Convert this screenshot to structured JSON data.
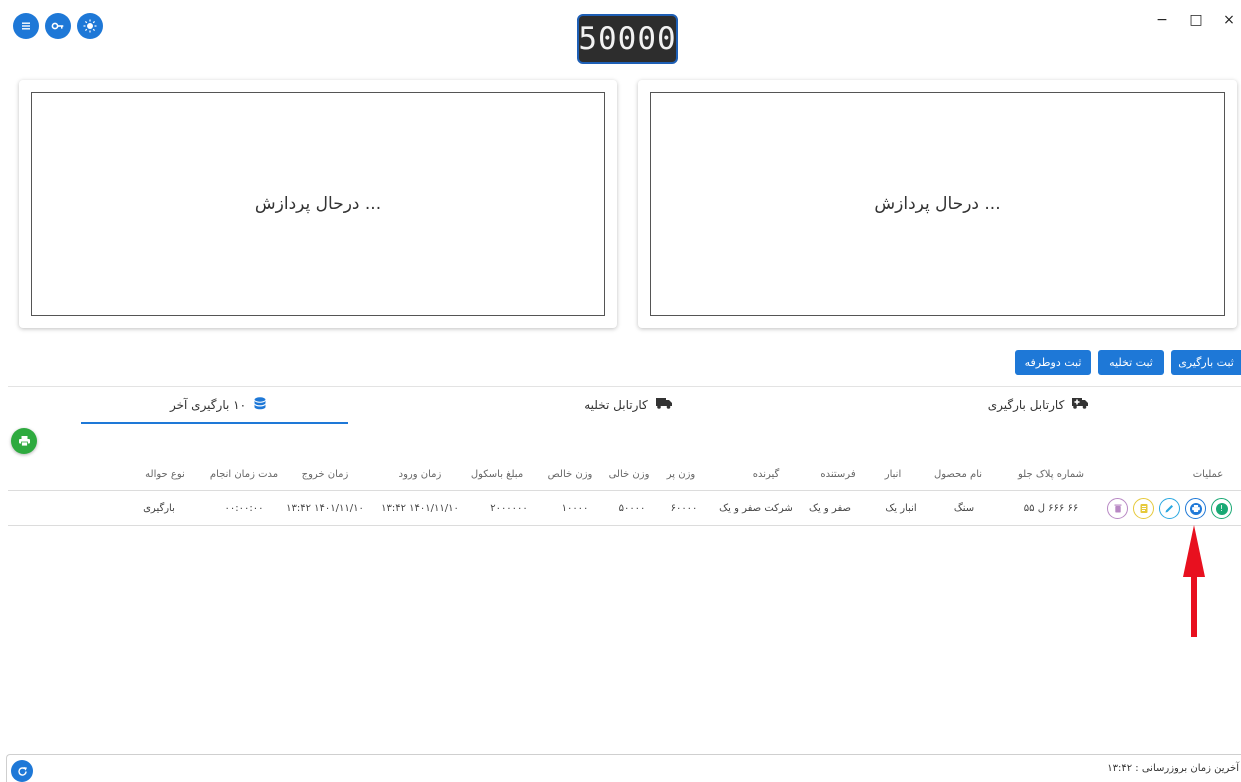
{
  "header": {
    "scale_reading": "50000",
    "icons": [
      "menu-icon",
      "key-icon",
      "brightness-icon"
    ],
    "window_controls": {
      "minimize": "−",
      "maximize": "□",
      "close": "×"
    }
  },
  "cameras": [
    {
      "status": "درحال پردازش ..."
    },
    {
      "status": "درحال پردازش ..."
    }
  ],
  "actions": {
    "loading": "ثبت بارگیری",
    "unloading": "ثبت تخلیه",
    "two_way": "ثبت دوطرفه"
  },
  "tabs": [
    {
      "label": "کارتابل بارگیری",
      "icon": "truck-medical-icon"
    },
    {
      "label": "کارتابل تخلیه",
      "icon": "truck-icon"
    },
    {
      "label": "۱۰ بارگیری آخر",
      "icon": "database-icon",
      "active": true
    }
  ],
  "table": {
    "headers": {
      "ops": "عملیات",
      "plate": "شماره پلاک جلو",
      "product": "نام محصول",
      "warehouse": "انبار",
      "sender": "فرستنده",
      "receiver": "گیرنده",
      "full_weight": "وزن پر",
      "empty_weight": "وزن خالی",
      "net_weight": "وزن خالص",
      "scale_fee": "مبلغ باسکول",
      "entry_time": "زمان ورود",
      "exit_time": "زمان خروج",
      "duration": "مدت زمان انجام",
      "type": "نوع حواله"
    },
    "rows": [
      {
        "plate": "۶۶ ۶۶۶ ل ۵۵",
        "product": "سنگ",
        "warehouse": "انبار یک",
        "sender": "صفر و یک",
        "receiver": "شرکت صفر و یک",
        "full_weight": "۶۰۰۰۰",
        "empty_weight": "۵۰۰۰۰",
        "net_weight": "۱۰۰۰۰",
        "scale_fee": "۲۰۰۰۰۰۰",
        "entry_time": "۱۳:۴۲ ۱۴۰۱/۱۱/۱۰",
        "exit_time": "۱۳:۴۲ ۱۴۰۱/۱۱/۱۰",
        "duration": "۰۰:۰۰:۰۰",
        "type": "بارگیری"
      }
    ]
  },
  "colors": {
    "primary": "#1e78d7",
    "print_green": "#2eaa3f",
    "arrow_red": "#e8101f",
    "op_info": "#19a974",
    "op_print": "#1e78d7",
    "op_edit": "#2aa7e0",
    "op_doc": "#e6c93a",
    "op_delete": "#b888c4"
  },
  "footer": {
    "last_update": "آخرین زمان بروزرسانی : ۱۳:۴۲"
  }
}
